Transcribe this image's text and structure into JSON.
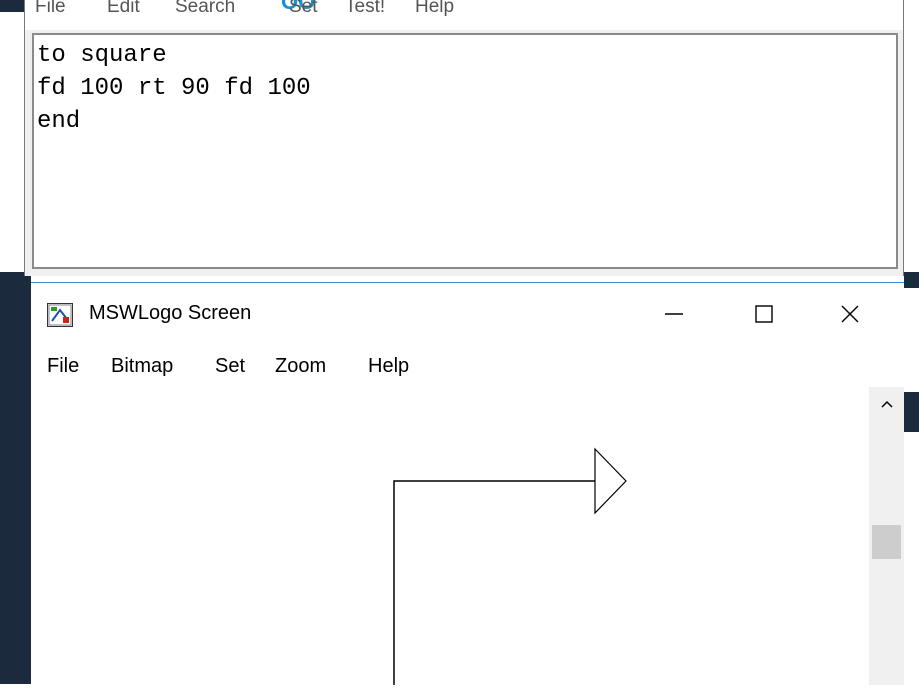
{
  "editor": {
    "menu": [
      "File",
      "Edit",
      "Search",
      "Set",
      "Test!",
      "Help"
    ],
    "code_lines": [
      "to square",
      "fd 100 rt 90 fd 100",
      "end"
    ]
  },
  "screen_window": {
    "title": "MSWLogo Screen",
    "controls": {
      "minimize_icon": "minimize-icon",
      "maximize_icon": "maximize-icon",
      "close_icon": "close-icon"
    },
    "menu": [
      "File",
      "Bitmap",
      "Set",
      "Zoom",
      "Help"
    ],
    "icon": "mswlogo-app-icon"
  },
  "colors": {
    "desktop": "#1b2b3d",
    "window_border": "#3c8dd0"
  }
}
